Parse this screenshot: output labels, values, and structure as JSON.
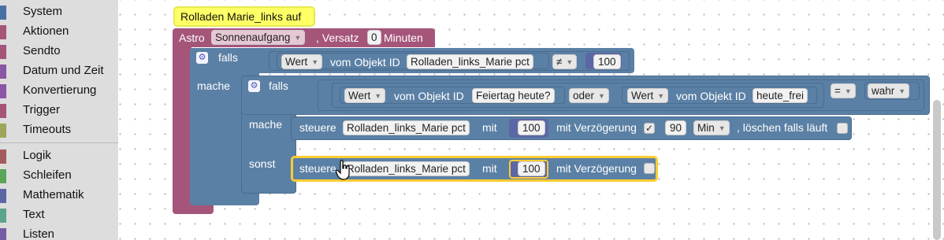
{
  "toolbox": {
    "items": [
      {
        "label": "System",
        "color": "#4a6fa5"
      },
      {
        "label": "Aktionen",
        "color": "#a5557a"
      },
      {
        "label": "Sendto",
        "color": "#a5557a"
      },
      {
        "label": "Datum und Zeit",
        "color": "#8a56a5"
      },
      {
        "label": "Konvertierung",
        "color": "#8a56a5"
      },
      {
        "label": "Trigger",
        "color": "#a5557a"
      },
      {
        "label": "Timeouts",
        "color": "#9ea55a"
      },
      {
        "label": "Logik",
        "color": "#a55b5b"
      },
      {
        "label": "Schleifen",
        "color": "#5ba55b"
      },
      {
        "label": "Mathematik",
        "color": "#5b67a5"
      },
      {
        "label": "Text",
        "color": "#5ba58c"
      },
      {
        "label": "Listen",
        "color": "#745ba5"
      }
    ]
  },
  "comment": {
    "text": "Rolladen Marie_links auf"
  },
  "astro": {
    "label": "Astro",
    "event": "Sonnenaufgang",
    "offset_label": ", Versatz",
    "offset": "0",
    "unit": "Minuten"
  },
  "if1": {
    "falls": "falls",
    "mache": "mache",
    "cond": {
      "prop": "Wert",
      "of_label": "vom Objekt ID",
      "object": "Rolladen_links_Marie pct",
      "op": "≠",
      "value": "100"
    }
  },
  "if2": {
    "falls": "falls",
    "mache": "mache",
    "sonst": "sonst",
    "cond": {
      "left": {
        "prop": "Wert",
        "of_label": "vom Objekt ID",
        "object": "Feiertag heute?"
      },
      "logic": "oder",
      "right": {
        "prop": "Wert",
        "of_label": "vom Objekt ID",
        "object": "heute_frei"
      },
      "op": "=",
      "value": "wahr"
    }
  },
  "set1": {
    "verb": "steuere",
    "object": "Rolladen_links_Marie pct",
    "with": "mit",
    "value": "100",
    "delay_label": "mit Verzögerung",
    "delay_checked": "✓",
    "delay": "90",
    "delay_unit": "Min",
    "clear_label": ", löschen falls läuft"
  },
  "set2": {
    "verb": "steuere",
    "object": "Rolladen_links_Marie pct",
    "with": "mit",
    "value": "100",
    "delay_label": "mit Verzögerung"
  },
  "colors": {
    "astro": "#a5557a",
    "logic": "#5b80a5",
    "comment": "#ffff66",
    "selected": "#fc3"
  }
}
